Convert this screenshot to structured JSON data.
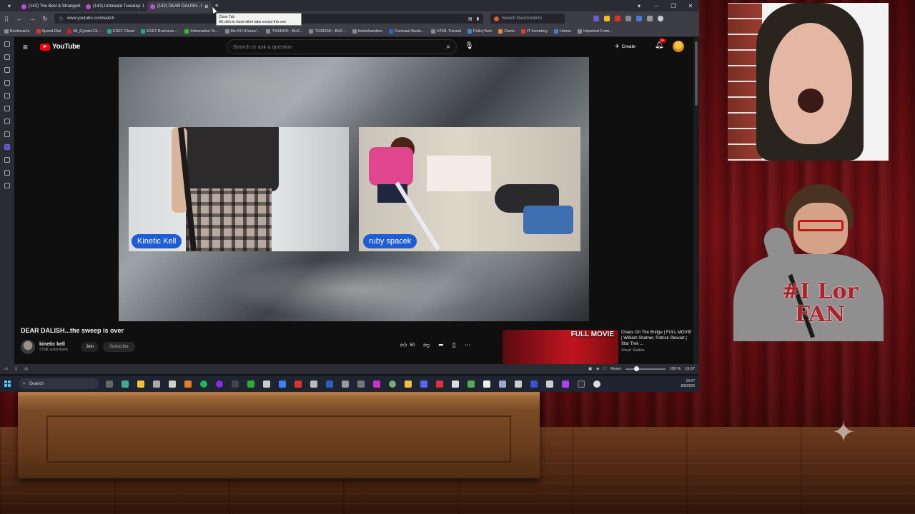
{
  "browser": {
    "tabs": [
      {
        "label": "(142) The Best & Strangest",
        "active": false
      },
      {
        "label": "(142) Untoward Tuesday: 1",
        "active": false
      },
      {
        "label": "(142) DEAR DALISH...t",
        "active": true
      }
    ],
    "tooltip": {
      "title": "Close Tab",
      "hint": "Alt click to close other tabs except this one"
    },
    "url": "www.youtube.com/watch",
    "search_placeholder": "Search DuckDuckGo",
    "bookmarks": [
      "Bookmarks",
      "Speed Dial",
      "Mi_Gymist Cli...",
      "ESET Cloud",
      "ESET Business ...",
      "Information Te...",
      "file:///C:/Users/...",
      "TS3400D - BUF...",
      "TS3400D - BUF...",
      "Homebamboo",
      "Comcast Busin...",
      "HTML Tutorial",
      "PolicyTech",
      "Canto",
      "IT Inventory",
      "Litmos",
      "Imported From..."
    ],
    "status_bar": {
      "reset_label": "Reset",
      "zoom": "100 %",
      "time": "19:07"
    }
  },
  "youtube": {
    "logo": "YouTube",
    "search_placeholder": "Search or ask a question",
    "create_label": "Create",
    "notif_badge": "9+",
    "video": {
      "title": "DEAR DALISH...the sweep is over",
      "left_name": "Kinetic Kell",
      "right_name": "ruby spacek"
    },
    "channel": {
      "name": "kinetic kell",
      "subscribers": "3.59K subscribers",
      "join_label": "Join",
      "subscribe_label": "Subscribe"
    },
    "likes": "50",
    "recommendation": {
      "badge": "FULL MOVIE",
      "title": "Chaos On The Bridge | FULL MOVIE | William Shatner, Patrick Stewart | Star Trek ...",
      "channel": "Shout! Studios"
    }
  },
  "taskbar": {
    "search_label": "Search",
    "clock_time": "19:07",
    "clock_date": "8/5/2026"
  },
  "overlay": {
    "sweater_print": "#I Lor FAN"
  }
}
